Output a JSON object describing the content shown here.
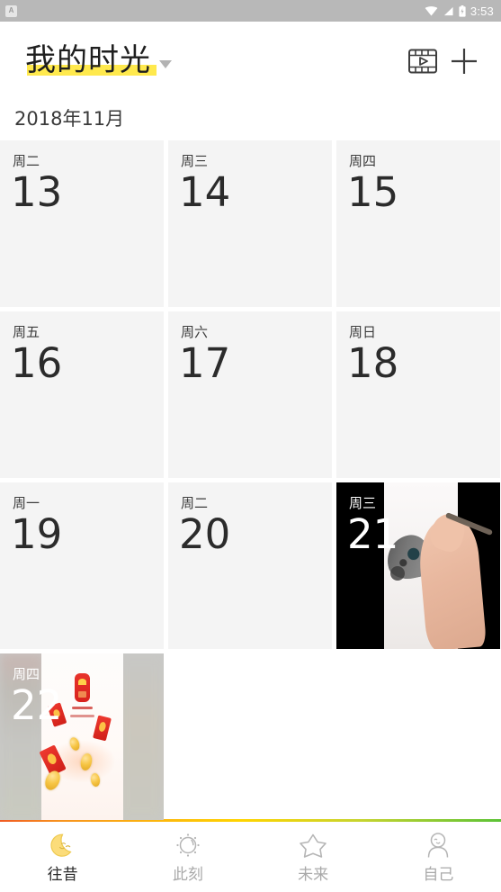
{
  "statusbar": {
    "notification_letter": "A",
    "time": "3:53",
    "icons": [
      "wifi-icon",
      "signal-icon",
      "battery-icon"
    ]
  },
  "header": {
    "title": "我的时光",
    "dropdown_icon": "chevron-down-icon",
    "actions": [
      {
        "name": "video-icon",
        "label": ""
      },
      {
        "name": "plus-icon",
        "label": ""
      }
    ]
  },
  "month_label": "2018年11月",
  "colors": {
    "highlight": "#ffe94d",
    "card_bg": "#f4f4f4",
    "accent_line_start": "#f05a22",
    "accent_line_mid": "#ffd400",
    "accent_line_end": "#5bc236",
    "active_nav_text": "#2b2b2b",
    "inactive_nav_text": "#a9a9a9"
  },
  "days": [
    {
      "weekday": "周二",
      "date": "13",
      "media": "none"
    },
    {
      "weekday": "周三",
      "date": "14",
      "media": "none"
    },
    {
      "weekday": "周四",
      "date": "15",
      "media": "none"
    },
    {
      "weekday": "周五",
      "date": "16",
      "media": "none"
    },
    {
      "weekday": "周六",
      "date": "17",
      "media": "none"
    },
    {
      "weekday": "周日",
      "date": "18",
      "media": "none"
    },
    {
      "weekday": "周一",
      "date": "19",
      "media": "none"
    },
    {
      "weekday": "周二",
      "date": "20",
      "media": "none"
    },
    {
      "weekday": "周三",
      "date": "21",
      "media": "hand-drawing-photo"
    },
    {
      "weekday": "周四",
      "date": "22",
      "media": "red-envelope-screenshot"
    }
  ],
  "bottom_nav": [
    {
      "label": "往昔",
      "icon": "moon-icon",
      "active": true
    },
    {
      "label": "此刻",
      "icon": "sun-icon",
      "active": false
    },
    {
      "label": "未来",
      "icon": "star-icon",
      "active": false
    },
    {
      "label": "自己",
      "icon": "person-icon",
      "active": false
    }
  ]
}
